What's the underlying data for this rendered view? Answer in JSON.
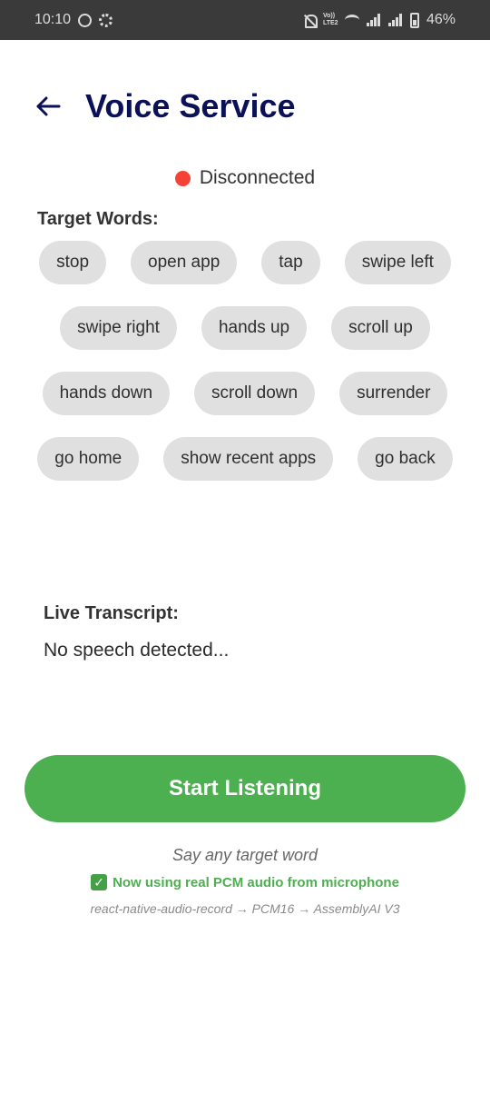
{
  "status_bar": {
    "time": "10:10",
    "volte": "Vo)) LTE2",
    "battery": "46%"
  },
  "header": {
    "title": "Voice Service"
  },
  "connection": {
    "status": "Disconnected",
    "status_color": "#f44336"
  },
  "target_words": {
    "label": "Target Words:",
    "words": [
      "stop",
      "open app",
      "tap",
      "swipe left",
      "swipe right",
      "hands up",
      "scroll up",
      "hands down",
      "scroll down",
      "surrender",
      "go home",
      "show recent apps",
      "go back"
    ]
  },
  "transcript": {
    "label": "Live Transcript:",
    "text": "No speech detected..."
  },
  "start_button": {
    "label": "Start Listening",
    "color": "#4caf50"
  },
  "hints": {
    "say": "Say any target word",
    "pcm": "Now using real PCM audio from microphone",
    "pipeline": "react-native-audio-record → PCM16 → AssemblyAI V3"
  },
  "icons": {
    "back": "back-arrow-icon",
    "check": "check-box-icon"
  }
}
